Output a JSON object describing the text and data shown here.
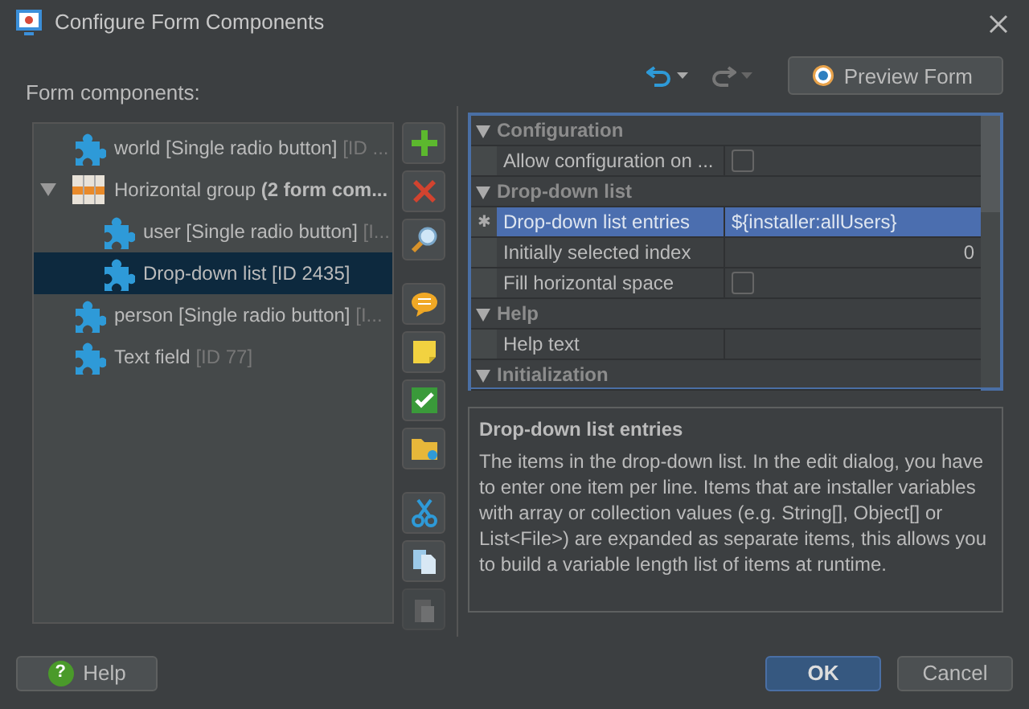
{
  "window": {
    "title": "Configure Form Components"
  },
  "toolbar": {
    "undo": {
      "disabled": false
    },
    "redo": {
      "disabled": true
    },
    "preview_button": "Preview Form"
  },
  "tree": {
    "label": "Form components:",
    "items": [
      {
        "text": "world [Single radio button]",
        "suffix": "[ID ...",
        "kind": "component",
        "selected": false
      },
      {
        "text": "Horizontal group **(2 form com...**",
        "kind": "group",
        "expanded": true,
        "selected": false,
        "children": [
          {
            "text": "user [Single radio button]",
            "suffix": "[I...",
            "kind": "component",
            "selected": false
          },
          {
            "text": "Drop-down list [ID 2435]",
            "kind": "component",
            "selected": true
          }
        ]
      },
      {
        "text": "person [Single radio button]",
        "suffix": "[I...",
        "kind": "component",
        "selected": false
      },
      {
        "text": "Text field",
        "suffix": "[ID 77]",
        "kind": "component",
        "selected": false
      }
    ]
  },
  "side_tools": [
    {
      "kind": "add",
      "disabled": false
    },
    {
      "kind": "delete",
      "disabled": false
    },
    {
      "kind": "search",
      "disabled": false
    },
    {
      "kind": "gap"
    },
    {
      "kind": "comment",
      "disabled": false
    },
    {
      "kind": "note",
      "disabled": false
    },
    {
      "kind": "check",
      "disabled": false
    },
    {
      "kind": "folder",
      "disabled": false
    },
    {
      "kind": "gap"
    },
    {
      "kind": "cut",
      "disabled": false
    },
    {
      "kind": "copy",
      "disabled": false
    },
    {
      "kind": "paste",
      "disabled": true
    }
  ],
  "properties": [
    {
      "category": "Configuration",
      "expanded": true,
      "rows": [
        {
          "name": "Allow configuration on ...",
          "kind": "checkbox",
          "checked": false,
          "selected": false
        }
      ]
    },
    {
      "category": "Drop-down list",
      "expanded": true,
      "rows": [
        {
          "name": "Drop-down list entries",
          "kind": "text",
          "value": "${installer:allUsers}",
          "marker": "✱",
          "selected": true
        },
        {
          "name": "Initially selected index",
          "kind": "number",
          "value": "0",
          "selected": false
        },
        {
          "name": "Fill horizontal space",
          "kind": "checkbox",
          "checked": false,
          "selected": false
        }
      ]
    },
    {
      "category": "Help",
      "expanded": true,
      "rows": [
        {
          "name": "Help text",
          "kind": "text",
          "selected": false
        }
      ]
    },
    {
      "category": "Initialization",
      "expanded": true
    }
  ],
  "description": {
    "title": "Drop-down list entries",
    "text": "The items in the drop-down list. In the edit dialog, you have to enter one item per line. Items that are installer variables with array or collection values (e.g. String[], Object[] or List<File>) are expanded as separate items, this allows you to build a variable length list of items at runtime."
  },
  "footer": {
    "help_glyph": "?",
    "help": "Help",
    "ok": "OK",
    "cancel": "Cancel"
  }
}
